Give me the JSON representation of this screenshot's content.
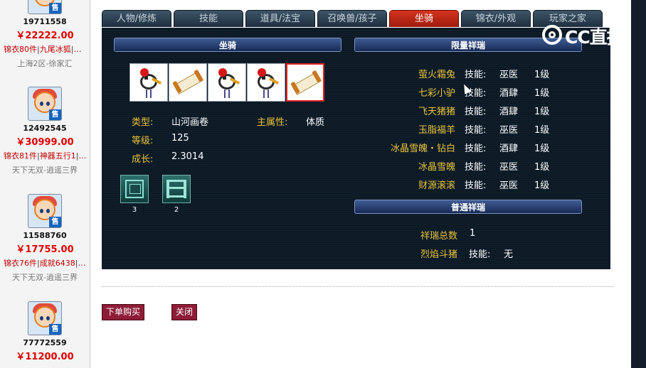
{
  "sidebar": {
    "listings": [
      {
        "id": "19711558",
        "price": "￥22222.00",
        "tags": [
          "锦衣80件",
          "九尾冰狐",
          "…"
        ],
        "server": "上海2区-徐家汇"
      },
      {
        "id": "12492545",
        "price": "￥30999.00",
        "tags": [
          "锦衣81件",
          "神器五行1",
          "…"
        ],
        "server": "天下无双-逍遥三界"
      },
      {
        "id": "11588760",
        "price": "￥17755.00",
        "tags": [
          "锦衣76件",
          "成就6438",
          "…"
        ],
        "server": "天下无双-逍遥三界"
      },
      {
        "id": "77772559",
        "price": "￥11200.00",
        "tags": [],
        "server": ""
      }
    ],
    "sale_badge": "售"
  },
  "tabs": [
    {
      "label": "人物/修炼",
      "active": false
    },
    {
      "label": "技能",
      "active": false
    },
    {
      "label": "道具/法宝",
      "active": false
    },
    {
      "label": "召唤兽/孩子",
      "active": false
    },
    {
      "label": "坐骑",
      "active": true
    },
    {
      "label": "锦衣/外观",
      "active": false
    },
    {
      "label": "玩家之家",
      "active": false
    }
  ],
  "mount_panel": {
    "title": "坐骑",
    "slots": [
      "crane",
      "scroll",
      "crane",
      "crane",
      "scroll"
    ],
    "selected_slot": 4,
    "attributes": {
      "type_label": "类型:",
      "type_value": "山河画卷",
      "main_attr_label": "主属性:",
      "main_attr_value": "体质",
      "level_label": "等级:",
      "level_value": "125",
      "growth_label": "成长:",
      "growth_value": "2.3014"
    },
    "gear": [
      {
        "icon": "frame-gear-icon",
        "count": "3"
      },
      {
        "icon": "wall-gear-icon",
        "count": "2"
      }
    ]
  },
  "xiangrui": {
    "limited_title": "限量祥瑞",
    "limited": [
      {
        "name": "萤火霜兔",
        "skill_label": "技能:",
        "faction": "巫医",
        "level": "1级"
      },
      {
        "name": "七彩小驴",
        "skill_label": "技能:",
        "faction": "酒肆",
        "level": "1级"
      },
      {
        "name": "飞天猪猪",
        "skill_label": "技能:",
        "faction": "酒肆",
        "level": "1级"
      },
      {
        "name": "玉脂福羊",
        "skill_label": "技能:",
        "faction": "巫医",
        "level": "1级"
      },
      {
        "name": "冰晶雪魄・钻白",
        "skill_label": "技能:",
        "faction": "酒肆",
        "level": "1级"
      },
      {
        "name": "冰晶雪魄",
        "skill_label": "技能:",
        "faction": "巫医",
        "level": "1级"
      },
      {
        "name": "财源滚滚",
        "skill_label": "技能:",
        "faction": "巫医",
        "level": "1级"
      }
    ],
    "normal_title": "普通祥瑞",
    "normal": {
      "total_label": "祥瑞总数",
      "total_value": "1",
      "item_name": "烈焰斗猪",
      "item_skill_label": "技能:",
      "item_skill_value": "无"
    }
  },
  "actions": {
    "buy_label": "下单购买",
    "close_label": "关闭"
  },
  "logo": {
    "text": "CC直播"
  },
  "colors": {
    "active_tab": "#c4281a",
    "panel_bg": "#0c1a26",
    "label_gold": "#e8c23a",
    "button": "#8e1d37",
    "price_red": "#e00000"
  }
}
